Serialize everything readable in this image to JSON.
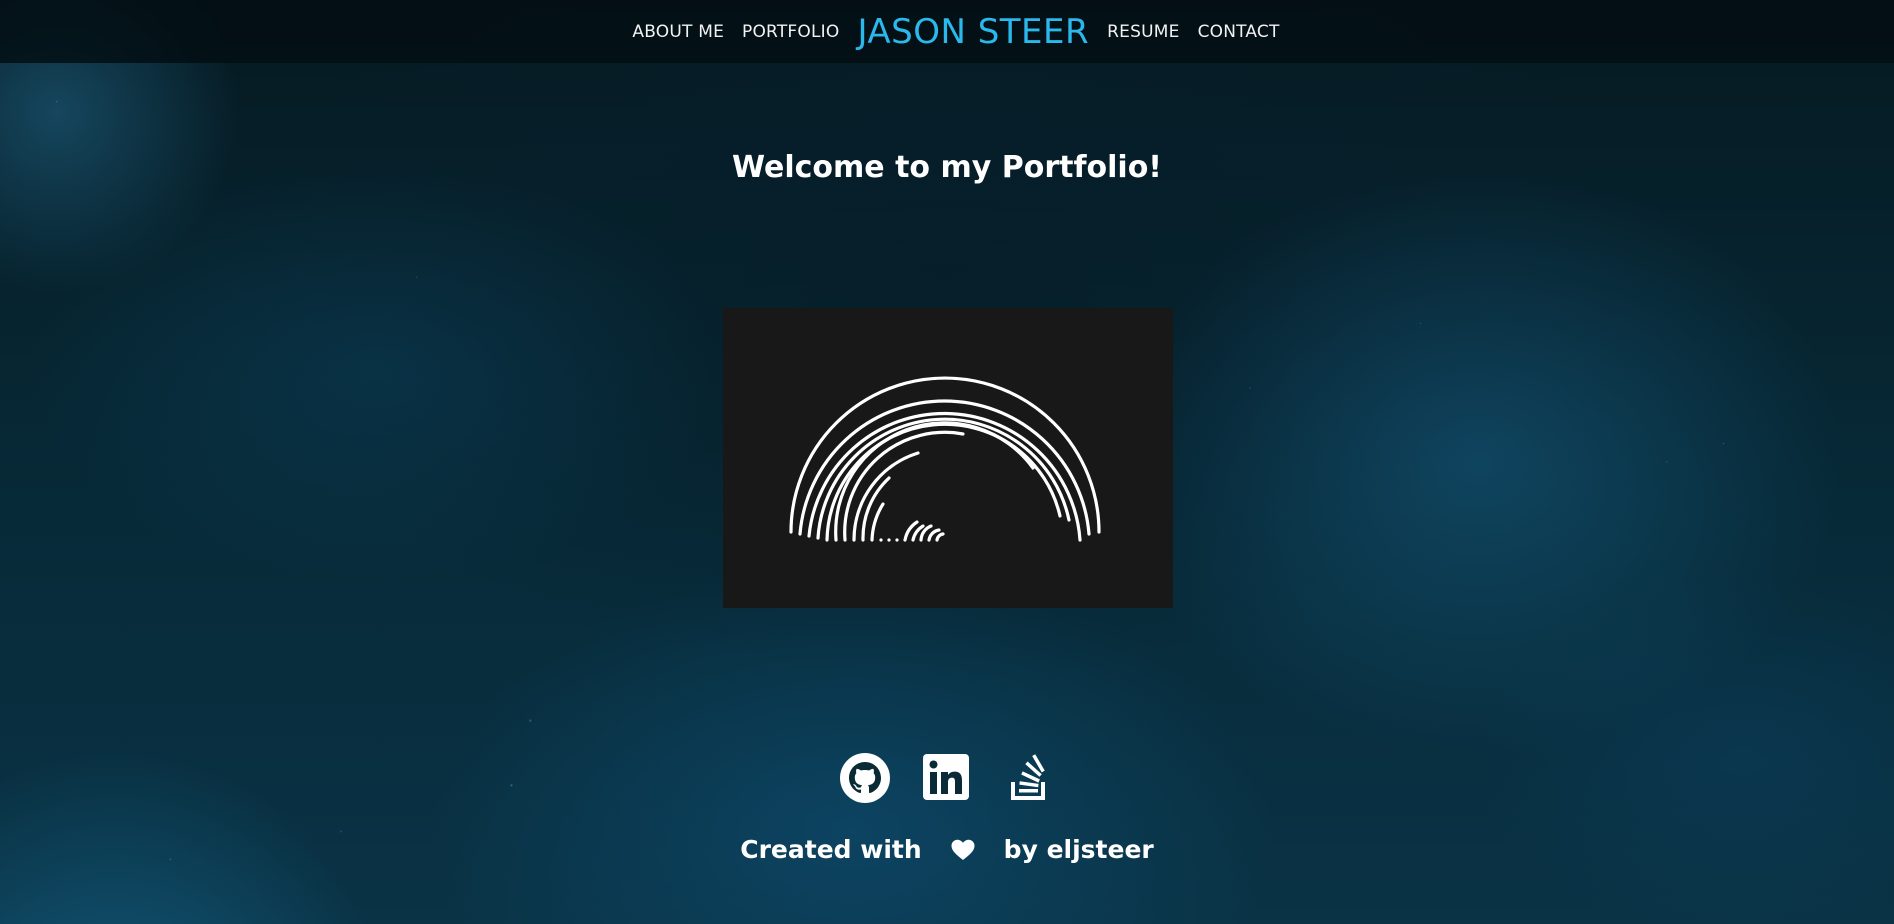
{
  "nav": {
    "left_links": [
      "ABOUT ME",
      "PORTFOLIO"
    ],
    "brand": "JASON STEER",
    "right_links": [
      "RESUME",
      "CONTACT"
    ],
    "brand_color": "#2bb8ec"
  },
  "main": {
    "heading": "Welcome to my Portfolio!",
    "project_image_icon": "concentric-arcs-logo"
  },
  "footer": {
    "social_icons": [
      "github-icon",
      "linkedin-icon",
      "stackoverflow-icon"
    ],
    "credit_prefix": "Created with",
    "credit_icon": "heart-icon",
    "credit_suffix": "by eljsteer"
  },
  "colors": {
    "background": "#06222b",
    "navbar": "#020e12",
    "card": "#181818",
    "text": "#ffffff"
  }
}
